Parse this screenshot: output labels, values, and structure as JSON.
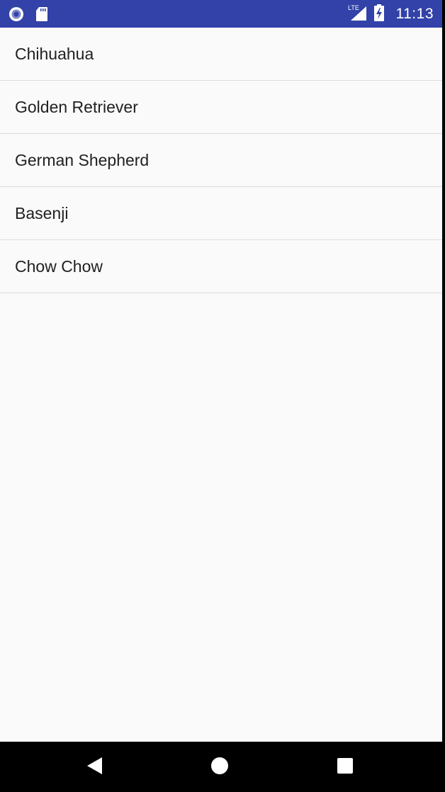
{
  "status_bar": {
    "time": "11:13",
    "network_label": "LTE",
    "background_color": "#3242a8",
    "left_icons": [
      "record-icon",
      "sd-card-icon"
    ],
    "right_icons": [
      "lte-signal-icon",
      "battery-charging-icon"
    ]
  },
  "list": {
    "items": [
      {
        "label": "Chihuahua"
      },
      {
        "label": "Golden Retriever"
      },
      {
        "label": "German Shepherd"
      },
      {
        "label": "Basenji"
      },
      {
        "label": "Chow Chow"
      }
    ]
  },
  "nav_bar": {
    "buttons": [
      "back-icon",
      "home-icon",
      "recents-icon"
    ]
  }
}
